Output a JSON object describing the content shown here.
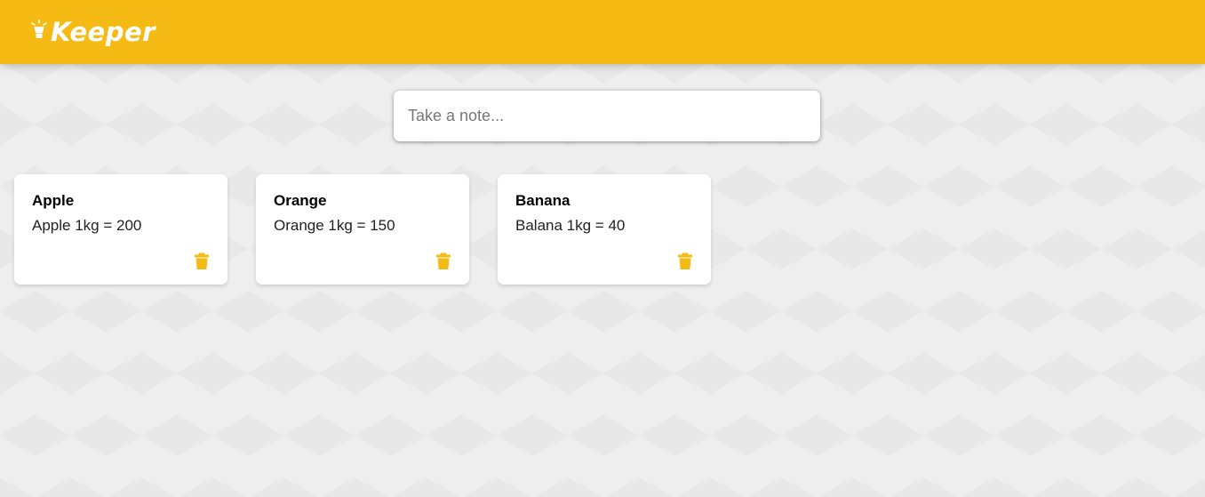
{
  "header": {
    "title": "Keeper",
    "logo_icon": "lightbulb-icon"
  },
  "create_note": {
    "placeholder": "Take a note..."
  },
  "notes": [
    {
      "title": "Apple",
      "content": "Apple 1kg = 200",
      "action_icon": "trash-icon"
    },
    {
      "title": "Orange",
      "content": "Orange 1kg = 150",
      "action_icon": "trash-icon"
    },
    {
      "title": "Banana",
      "content": "Balana 1kg = 40",
      "action_icon": "trash-icon"
    }
  ],
  "colors": {
    "accent": "#f5ba13",
    "background": "#eeeeee",
    "card": "#ffffff"
  }
}
